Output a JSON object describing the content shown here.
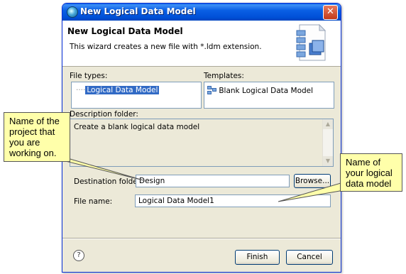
{
  "window": {
    "title": "New Logical Data Model",
    "close_glyph": "✕"
  },
  "header": {
    "title": "New Logical Data Model",
    "description": "This wizard creates a new file with *.ldm extension.",
    "icon": "logical-data-model-wizard-icon"
  },
  "file_types": {
    "label": "File types:",
    "items": [
      "Logical Data Model"
    ],
    "selected": "Logical Data Model"
  },
  "templates": {
    "label": "Templates:",
    "items": [
      "Blank Logical Data Model"
    ]
  },
  "description_folder": {
    "label": "Description folder:",
    "text": "Create a blank logical data model"
  },
  "destination_folder": {
    "label": "Destination folder:",
    "value": "Design",
    "browse_label": "Browse..."
  },
  "file_name": {
    "label": "File name:",
    "value": "Logical Data Model1"
  },
  "footer": {
    "help_glyph": "?",
    "finish_label": "Finish",
    "cancel_label": "Cancel"
  },
  "callouts": {
    "project": "Name of the project that you are working on.",
    "model": "Name of your logical data model"
  },
  "colors": {
    "titlebar": "#0a5fe4",
    "dialog_bg": "#ece9d8",
    "selection": "#316ac5",
    "callout_bg": "#ffffaa"
  }
}
